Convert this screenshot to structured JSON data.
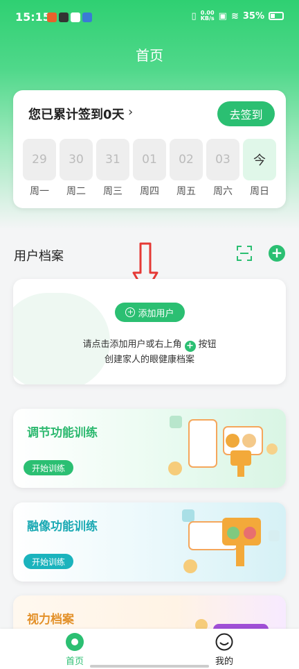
{
  "status_bar": {
    "time": "15:15",
    "net_speed_value": "0.00",
    "net_speed_unit": "KB/s",
    "battery": "35%"
  },
  "header": {
    "title": "首页"
  },
  "checkin": {
    "title": "您已累计签到0天",
    "button_label": "去签到",
    "days": [
      {
        "date": "29",
        "weekday": "周一",
        "today": false
      },
      {
        "date": "30",
        "weekday": "周二",
        "today": false
      },
      {
        "date": "31",
        "weekday": "周三",
        "today": false
      },
      {
        "date": "01",
        "weekday": "周四",
        "today": false
      },
      {
        "date": "02",
        "weekday": "周五",
        "today": false
      },
      {
        "date": "03",
        "weekday": "周六",
        "today": false
      },
      {
        "date": "今",
        "weekday": "周日",
        "today": true
      }
    ]
  },
  "profiles": {
    "title": "用户档案",
    "add_user_label": "添加用户",
    "hint_part1": "请点击添加用户或右上角",
    "hint_part2": "按钮",
    "hint_line2": "创建家人的眼健康档案"
  },
  "trainings": [
    {
      "title": "调节功能训练",
      "button": "开始训练"
    },
    {
      "title": "融像功能训练",
      "button": "开始训练"
    },
    {
      "title": "视力档案",
      "button": ""
    }
  ],
  "bottom_nav": [
    {
      "label": "首页",
      "active": true
    },
    {
      "label": "我的",
      "active": false
    }
  ],
  "colors": {
    "accent": "#2bbf72",
    "secondary": "#1bb3bd",
    "arrow": "#e53935"
  }
}
